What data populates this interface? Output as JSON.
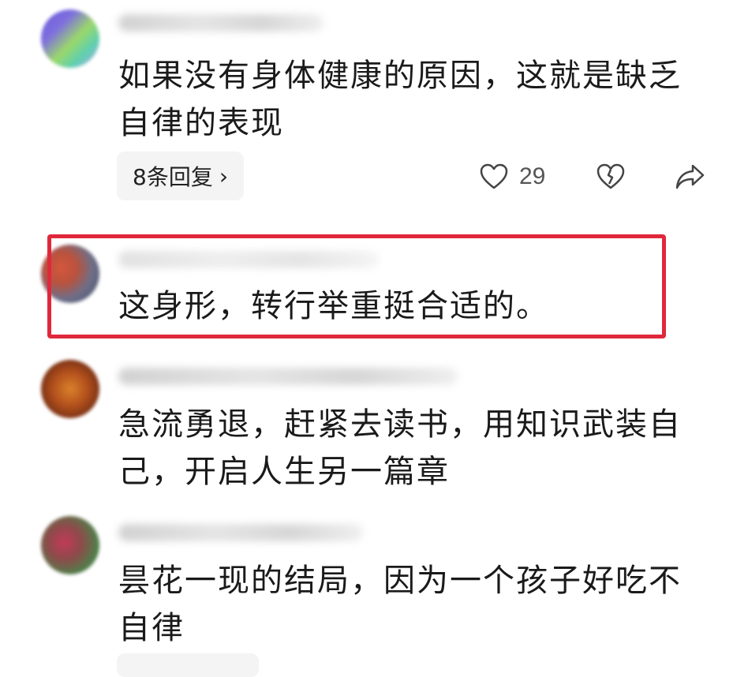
{
  "comments": [
    {
      "text": "如果没有身体健康的原因，这就是缺乏自律的表现",
      "line1": "如果没有身体健康的原因，这就是缺乏",
      "line2": "自律的表现",
      "replies_label": "8条回复",
      "likes": "29"
    },
    {
      "line1": "这身形，转行举重挺合适的。"
    },
    {
      "line1": "急流勇退，赶紧去读书，用知识武装自",
      "line2": "己，开启人生另一篇章"
    },
    {
      "line1": "昙花一现的结局，因为一个孩子好吃不",
      "line2": "自律"
    }
  ],
  "colors": {
    "highlight_border": "#e0283b",
    "text": "#1a1a1a",
    "pill_bg": "#f4f4f4"
  },
  "icons": [
    "heart-outline-icon",
    "dislike-broken-heart-icon",
    "share-arrow-icon",
    "chevron-right-icon"
  ]
}
